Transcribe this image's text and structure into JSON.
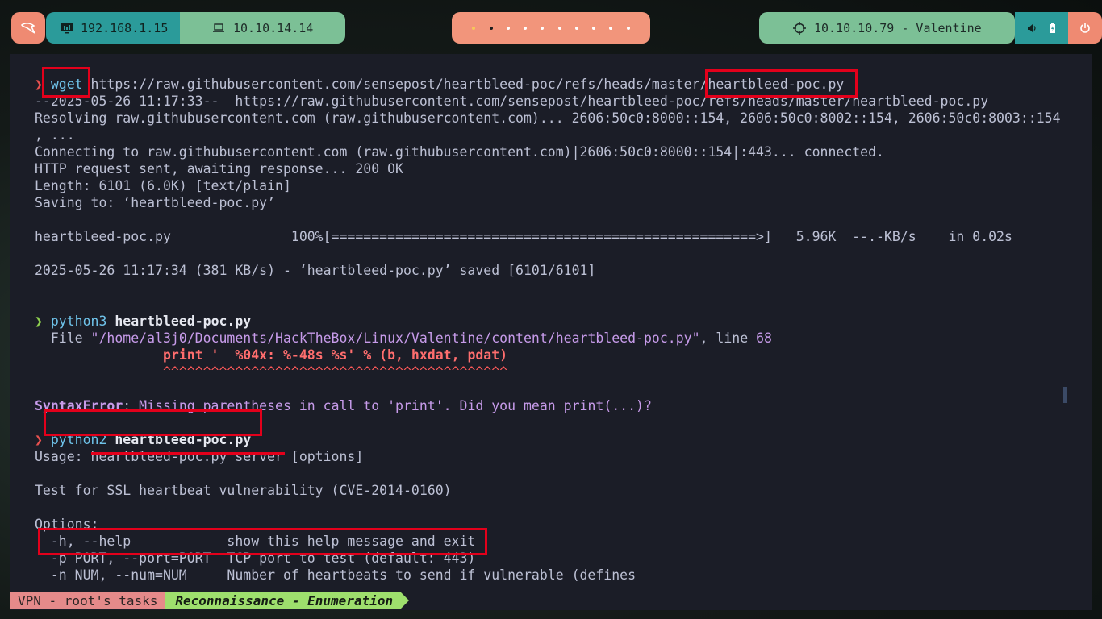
{
  "topbar": {
    "host_ip": "192.168.1.15",
    "vpn_ip": "10.10.14.14",
    "target": "10.10.10.79 - Valentine",
    "workspaces": 10,
    "active_workspace": 2
  },
  "terminal": {
    "lines": [
      {
        "parts": [
          {
            "t": "❯ ",
            "c": "arrow-red"
          },
          {
            "t": "wget",
            "c": "cmd"
          },
          {
            "t": " https://raw.githubusercontent.com/sensepost/heartbleed-poc/refs/heads/master/heartbleed-poc.py",
            "c": ""
          }
        ]
      },
      {
        "parts": [
          {
            "t": "--2025-05-26 11:17:33--  https://raw.githubusercontent.com/sensepost/heartbleed-poc/refs/heads/master/heartbleed-poc.py",
            "c": ""
          }
        ]
      },
      {
        "parts": [
          {
            "t": "Resolving raw.githubusercontent.com (raw.githubusercontent.com)... 2606:50c0:8000::154, 2606:50c0:8002::154, 2606:50c0:8003::154",
            "c": ""
          }
        ]
      },
      {
        "parts": [
          {
            "t": ", ...",
            "c": ""
          }
        ]
      },
      {
        "parts": [
          {
            "t": "Connecting to raw.githubusercontent.com (raw.githubusercontent.com)|2606:50c0:8000::154|:443... connected.",
            "c": ""
          }
        ]
      },
      {
        "parts": [
          {
            "t": "HTTP request sent, awaiting response... 200 OK",
            "c": ""
          }
        ]
      },
      {
        "parts": [
          {
            "t": "Length: 6101 (6.0K) [text/plain]",
            "c": ""
          }
        ]
      },
      {
        "parts": [
          {
            "t": "Saving to: ‘heartbleed-poc.py’",
            "c": ""
          }
        ]
      },
      {
        "parts": [
          {
            "t": "",
            "c": ""
          }
        ]
      },
      {
        "parts": [
          {
            "t": "heartbleed-poc.py               100%[=====================================================>]   5.96K  --.-KB/s    in 0.02s",
            "c": ""
          }
        ]
      },
      {
        "parts": [
          {
            "t": "",
            "c": ""
          }
        ]
      },
      {
        "parts": [
          {
            "t": "2025-05-26 11:17:34 (381 KB/s) - ‘heartbleed-poc.py’ saved [6101/6101]",
            "c": ""
          }
        ]
      },
      {
        "parts": [
          {
            "t": "",
            "c": ""
          }
        ]
      },
      {
        "parts": [
          {
            "t": "",
            "c": ""
          }
        ]
      },
      {
        "parts": [
          {
            "t": "❯ ",
            "c": "arrow-green"
          },
          {
            "t": "python3",
            "c": "cmd"
          },
          {
            "t": " ",
            "c": ""
          },
          {
            "t": "heartbleed-poc.py",
            "c": "bold"
          }
        ]
      },
      {
        "parts": [
          {
            "t": "  File ",
            "c": ""
          },
          {
            "t": "\"/home/al3j0/Documents/HackTheBox/Linux/Valentine/content/heartbleed-poc.py\"",
            "c": "path"
          },
          {
            "t": ", line ",
            "c": ""
          },
          {
            "t": "68",
            "c": "num"
          }
        ]
      },
      {
        "parts": [
          {
            "t": "                ",
            "c": ""
          },
          {
            "t": "print '  %04x: %-48s %s' % (b, hxdat, pdat)",
            "c": "code"
          }
        ]
      },
      {
        "parts": [
          {
            "t": "                ",
            "c": ""
          },
          {
            "t": "^^^^^^^^^^^^^^^^^^^^^^^^^^^^^^^^^^^^^^^^^^^",
            "c": "carets"
          }
        ]
      },
      {
        "parts": [
          {
            "t": "",
            "c": ""
          }
        ]
      },
      {
        "parts": [
          {
            "t": "SyntaxError",
            "c": "err"
          },
          {
            "t": ": ",
            "c": ""
          },
          {
            "t": "Missing parentheses in call to 'print'. Did you mean print(...)?",
            "c": "errmsg"
          }
        ]
      },
      {
        "parts": [
          {
            "t": "",
            "c": ""
          }
        ]
      },
      {
        "parts": [
          {
            "t": "❯ ",
            "c": "arrow-red"
          },
          {
            "t": "python2",
            "c": "cmd"
          },
          {
            "t": " ",
            "c": ""
          },
          {
            "t": "heartbleed-poc.py",
            "c": "bold"
          }
        ]
      },
      {
        "parts": [
          {
            "t": "Usage: heartbleed-poc.py server [options]",
            "c": ""
          }
        ]
      },
      {
        "parts": [
          {
            "t": "",
            "c": ""
          }
        ]
      },
      {
        "parts": [
          {
            "t": "Test for SSL heartbeat vulnerability (CVE-2014-0160)",
            "c": ""
          }
        ]
      },
      {
        "parts": [
          {
            "t": "",
            "c": ""
          }
        ]
      },
      {
        "parts": [
          {
            "t": "Options:",
            "c": ""
          }
        ]
      },
      {
        "parts": [
          {
            "t": "  -h, --help            show this help message and exit",
            "c": ""
          }
        ]
      },
      {
        "parts": [
          {
            "t": "  -p PORT, --port=PORT  TCP port to test (default: 443)",
            "c": ""
          }
        ]
      },
      {
        "parts": [
          {
            "t": "  -n NUM, --num=NUM     Number of heartbeats to send if vulnerable (defines",
            "c": ""
          }
        ]
      }
    ]
  },
  "statusbar": {
    "session": "VPN - root's tasks",
    "window": "Reconnaissance - Enumeration"
  }
}
